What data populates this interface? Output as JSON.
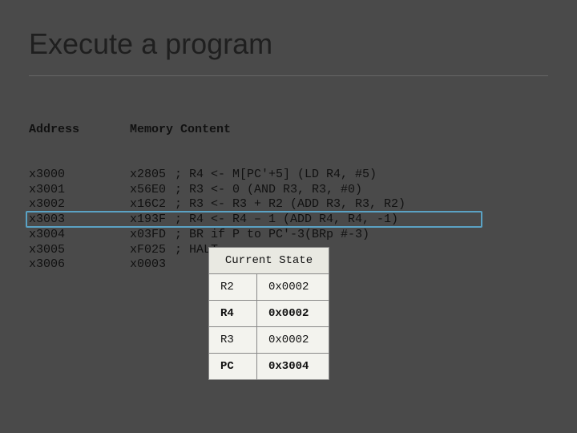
{
  "title": "Execute a program",
  "headers": {
    "address": "Address",
    "memory": "Memory Content"
  },
  "rows": [
    {
      "addr": "x3000",
      "mem": "x2805",
      "cmt": "; R4 <- M[PC'+5] (LD R4, #5)"
    },
    {
      "addr": "x3001",
      "mem": "x56E0",
      "cmt": "; R3 <- 0 (AND R3, R3, #0)"
    },
    {
      "addr": "x3002",
      "mem": "x16C2",
      "cmt": "; R3 <- R3 + R2 (ADD R3, R3, R2)"
    },
    {
      "addr": "x3003",
      "mem": "x193F",
      "cmt": "; R4 <- R4 – 1 (ADD R4, R4, -1)"
    },
    {
      "addr": "x3004",
      "mem": "x03FD",
      "cmt": "; BR if P to PC'-3(BRp #-3)"
    },
    {
      "addr": "x3005",
      "mem": "xF025",
      "cmt": "; HALT"
    },
    {
      "addr": "x3006",
      "mem": "x0003",
      "cmt": ""
    }
  ],
  "highlight_index": 3,
  "state": {
    "title": "Current State",
    "entries": [
      {
        "reg": "R2",
        "val": "0x0002",
        "bold": false
      },
      {
        "reg": "R4",
        "val": "0x0002",
        "bold": true
      },
      {
        "reg": "R3",
        "val": "0x0002",
        "bold": false
      },
      {
        "reg": "PC",
        "val": "0x3004",
        "bold": true
      }
    ]
  }
}
